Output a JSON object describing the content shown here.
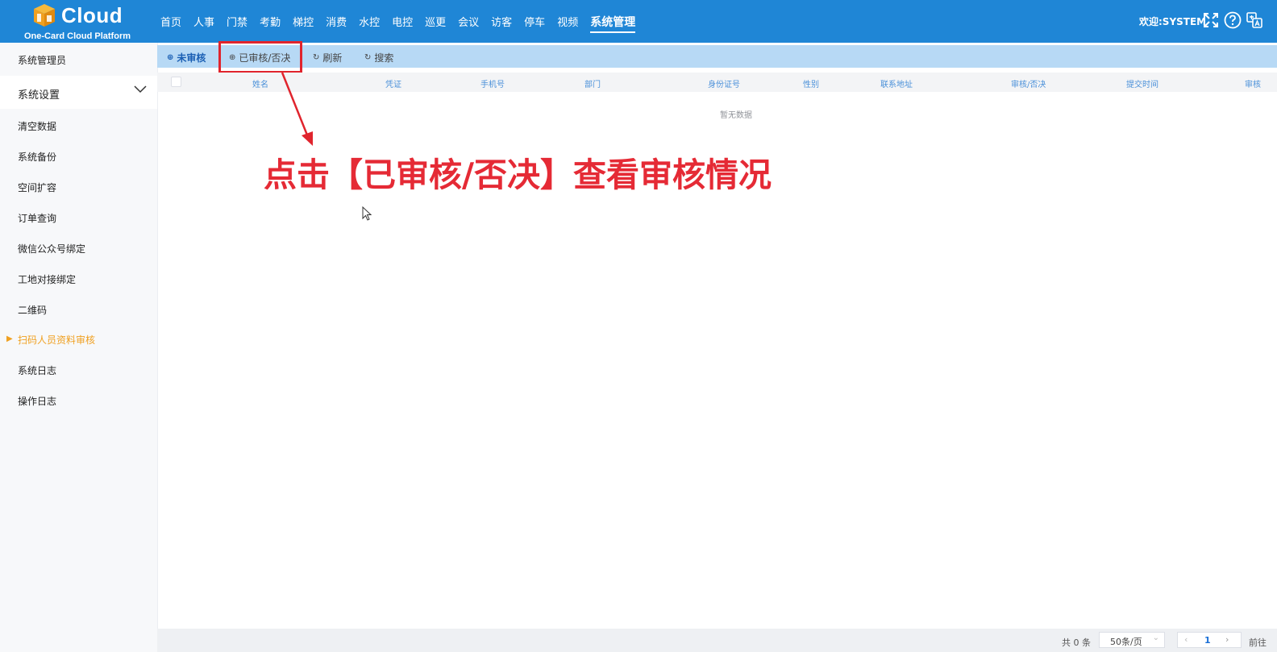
{
  "header": {
    "logo_text": "Cloud",
    "logo_subtitle": "One-Card Cloud Platform",
    "nav": [
      "首页",
      "人事",
      "门禁",
      "考勤",
      "梯控",
      "消费",
      "水控",
      "电控",
      "巡更",
      "会议",
      "访客",
      "停车",
      "视频",
      "系统管理"
    ],
    "active_nav": "系统管理",
    "welcome": "欢迎:SYSTEM",
    "icons": [
      "fullscreen-icon",
      "help-icon",
      "language-icon"
    ]
  },
  "sidebar": {
    "title": "系统管理员",
    "section": "系统设置",
    "items": [
      "清空数据",
      "系统备份",
      "空间扩容",
      "订单查询",
      "微信公众号绑定",
      "工地对接绑定",
      "二维码",
      "扫码人员资料审核",
      "系统日志",
      "操作日志"
    ],
    "active_item": "扫码人员资料审核"
  },
  "toolbar": {
    "buttons": [
      {
        "label": "未审核",
        "icon": "plus-circle-icon"
      },
      {
        "label": "已审核/否决",
        "icon": "plus-circle-icon"
      },
      {
        "label": "刷新",
        "icon": "refresh-icon"
      },
      {
        "label": "搜索",
        "icon": "search-icon"
      }
    ]
  },
  "table": {
    "columns": [
      "姓名",
      "凭证",
      "手机号",
      "部门",
      "身份证号",
      "性别",
      "联系地址",
      "审核/否决",
      "提交时间",
      "审核"
    ],
    "empty_text": "暂无数据"
  },
  "annotation": {
    "text": "点击【已审核/否决】查看审核情况",
    "color": "#e52a35"
  },
  "pagination": {
    "total": "共 0 条",
    "page_size": "50条/页",
    "current_page": "1",
    "goto_label": "前往"
  },
  "colors": {
    "header_bg": "#1f86d6",
    "toolbar_bg": "#b7d9f5",
    "accent_orange": "#f0a020",
    "annotation_red": "#e52a35"
  }
}
